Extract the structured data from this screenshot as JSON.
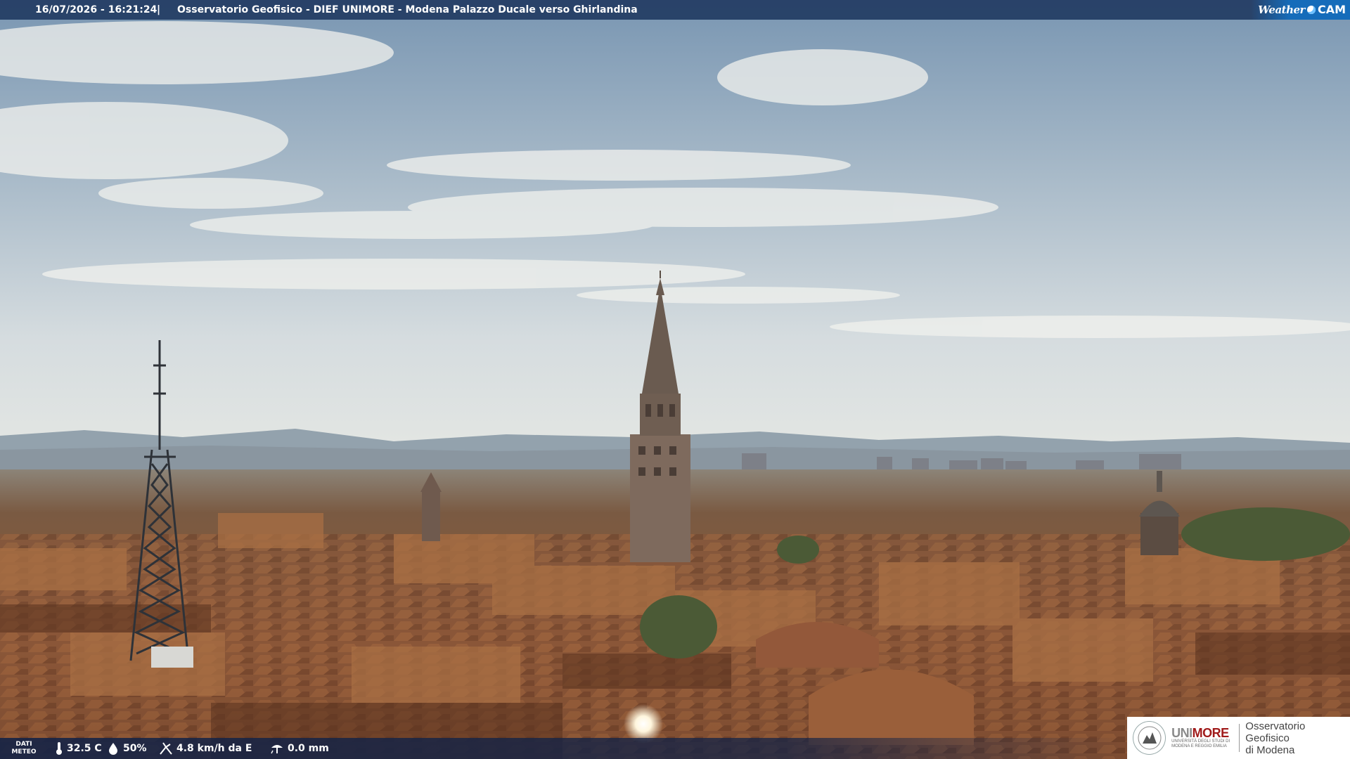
{
  "header": {
    "timestamp": "16/07/2026 - 16:21:24",
    "separator": "|",
    "title": "Osservatorio Geofisico - DIEF UNIMORE - Modena Palazzo Ducale verso Ghirlandina",
    "brand_word": "Weather",
    "brand_cam": "CAM"
  },
  "meteo": {
    "label_line1": "DATI",
    "label_line2": "METEO",
    "temperature": "32.5 C",
    "humidity": "50%",
    "wind": "4.8 km/h da E",
    "rain": "0.0 mm",
    "icons": [
      "thermometer-icon",
      "humidity-drop-icon",
      "wind-icon",
      "rain-gauge-icon"
    ]
  },
  "logo": {
    "name": "UNIMORE",
    "name_accent": "UNI",
    "subtitle_line1": "UNIVERSITÀ DEGLI STUDI DI",
    "subtitle_line2": "MODENA E REGGIO EMILIA",
    "observatory_line1": "Osservatorio Geofisico",
    "observatory_line2": "di Modena"
  },
  "colors": {
    "sky_top": "#7e9bb6",
    "sky_horizon": "#d8dfe2",
    "roofs": "#8a5a3a",
    "bar": "#1e375f",
    "brand_red": "#a01a1a"
  }
}
